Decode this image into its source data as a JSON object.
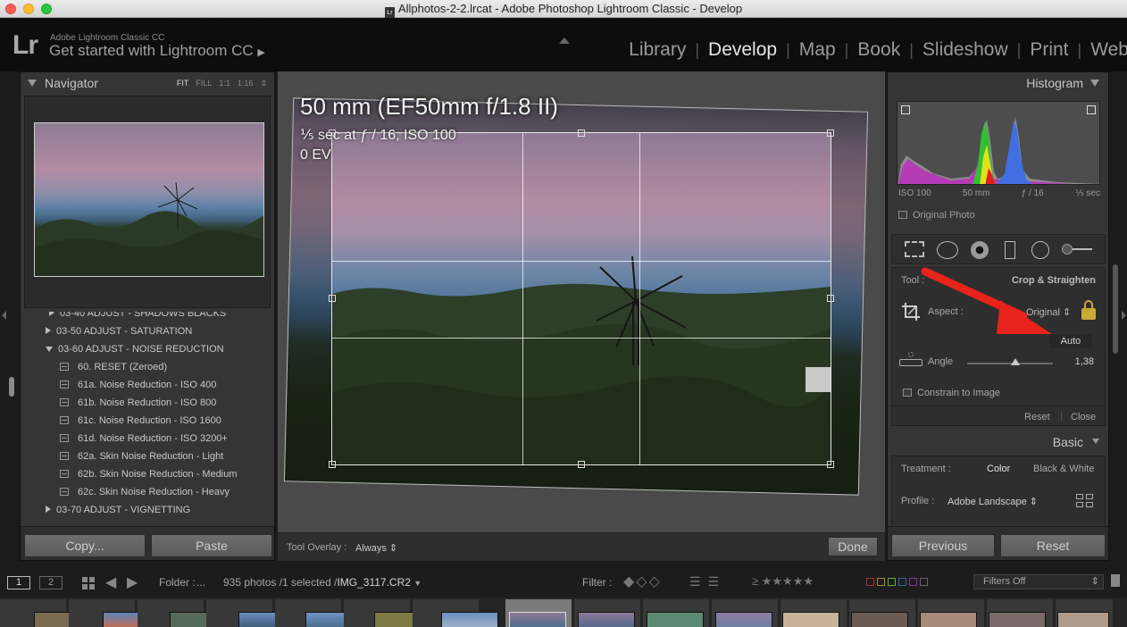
{
  "window": {
    "title": "Allphotos-2-2.lrcat - Adobe Photoshop Lightroom Classic - Develop",
    "doc_icon": "Lr"
  },
  "header": {
    "logo": "Lr",
    "identity_small": "Adobe Lightroom Classic CC",
    "identity_big": "Get started with Lightroom CC",
    "modules": [
      "Library",
      "Develop",
      "Map",
      "Book",
      "Slideshow",
      "Print",
      "Web"
    ],
    "active_module": "Develop"
  },
  "navigator": {
    "title": "Navigator",
    "zoom": [
      "FIT",
      "FILL",
      "1:1",
      "1:16"
    ],
    "zoom_active": "FIT"
  },
  "presets": {
    "items": [
      {
        "type": "folder",
        "expanded": false,
        "label": "03-40 ADJUST - SHADOWS BLACKS"
      },
      {
        "type": "folder",
        "expanded": false,
        "label": "03-50 ADJUST - SATURATION"
      },
      {
        "type": "folder",
        "expanded": true,
        "label": "03-60 ADJUST - NOISE REDUCTION"
      },
      {
        "type": "preset",
        "label": "60. RESET (Zeroed)"
      },
      {
        "type": "preset",
        "label": "61a. Noise Reduction - ISO 400"
      },
      {
        "type": "preset",
        "label": "61b. Noise Reduction - ISO 800"
      },
      {
        "type": "preset",
        "label": "61c. Noise Reduction - ISO 1600"
      },
      {
        "type": "preset",
        "label": "61d. Noise Reduction - ISO 3200+"
      },
      {
        "type": "preset",
        "label": "62a. Skin Noise Reduction - Light"
      },
      {
        "type": "preset",
        "label": "62b. Skin Noise Reduction - Medium"
      },
      {
        "type": "preset",
        "label": "62c. Skin Noise Reduction - Heavy"
      },
      {
        "type": "folder",
        "expanded": false,
        "label": "03-70 ADJUST - VIGNETTING"
      }
    ]
  },
  "left_buttons": {
    "copy": "Copy...",
    "paste": "Paste"
  },
  "photo_info": {
    "lens": "50 mm (EF50mm f/1.8 II)",
    "exposure": "⅕ sec at ƒ / 16, ISO 100",
    "ev": "0 EV"
  },
  "toolbar": {
    "overlay_label": "Tool Overlay :",
    "overlay_value": "Always",
    "done": "Done"
  },
  "histogram": {
    "title": "Histogram",
    "iso": "ISO 100",
    "focal": "50 mm",
    "aperture": "ƒ / 16",
    "shutter": "⅕ sec",
    "original_photo": "Original Photo"
  },
  "crop_tool": {
    "tool_label": "Tool :",
    "tool_name": "Crop & Straighten",
    "aspect_label": "Aspect :",
    "aspect_value": "Original",
    "auto": "Auto",
    "angle_label": "Angle",
    "angle_value": "1,38",
    "angle_fraction": 0.56,
    "constrain": "Constrain to Image",
    "reset": "Reset",
    "close": "Close"
  },
  "basic": {
    "title": "Basic",
    "treatment_label": "Treatment :",
    "color": "Color",
    "bw": "Black & White",
    "profile_label": "Profile :",
    "profile_value": "Adobe Landscape"
  },
  "right_buttons": {
    "previous": "Previous",
    "reset": "Reset"
  },
  "filmstrip_bar": {
    "screen1": "1",
    "screen2": "2",
    "folder_label": "Folder :",
    "folder_value": "...",
    "count": "935 photos /1 selected /",
    "filename": "IMG_3117.CR2",
    "filter_label": "Filter :",
    "filters_off": "Filters Off"
  },
  "colors": {
    "accent_red": "#e8231c",
    "panel_bg": "#353535",
    "active_module": "#e6e6e6"
  }
}
